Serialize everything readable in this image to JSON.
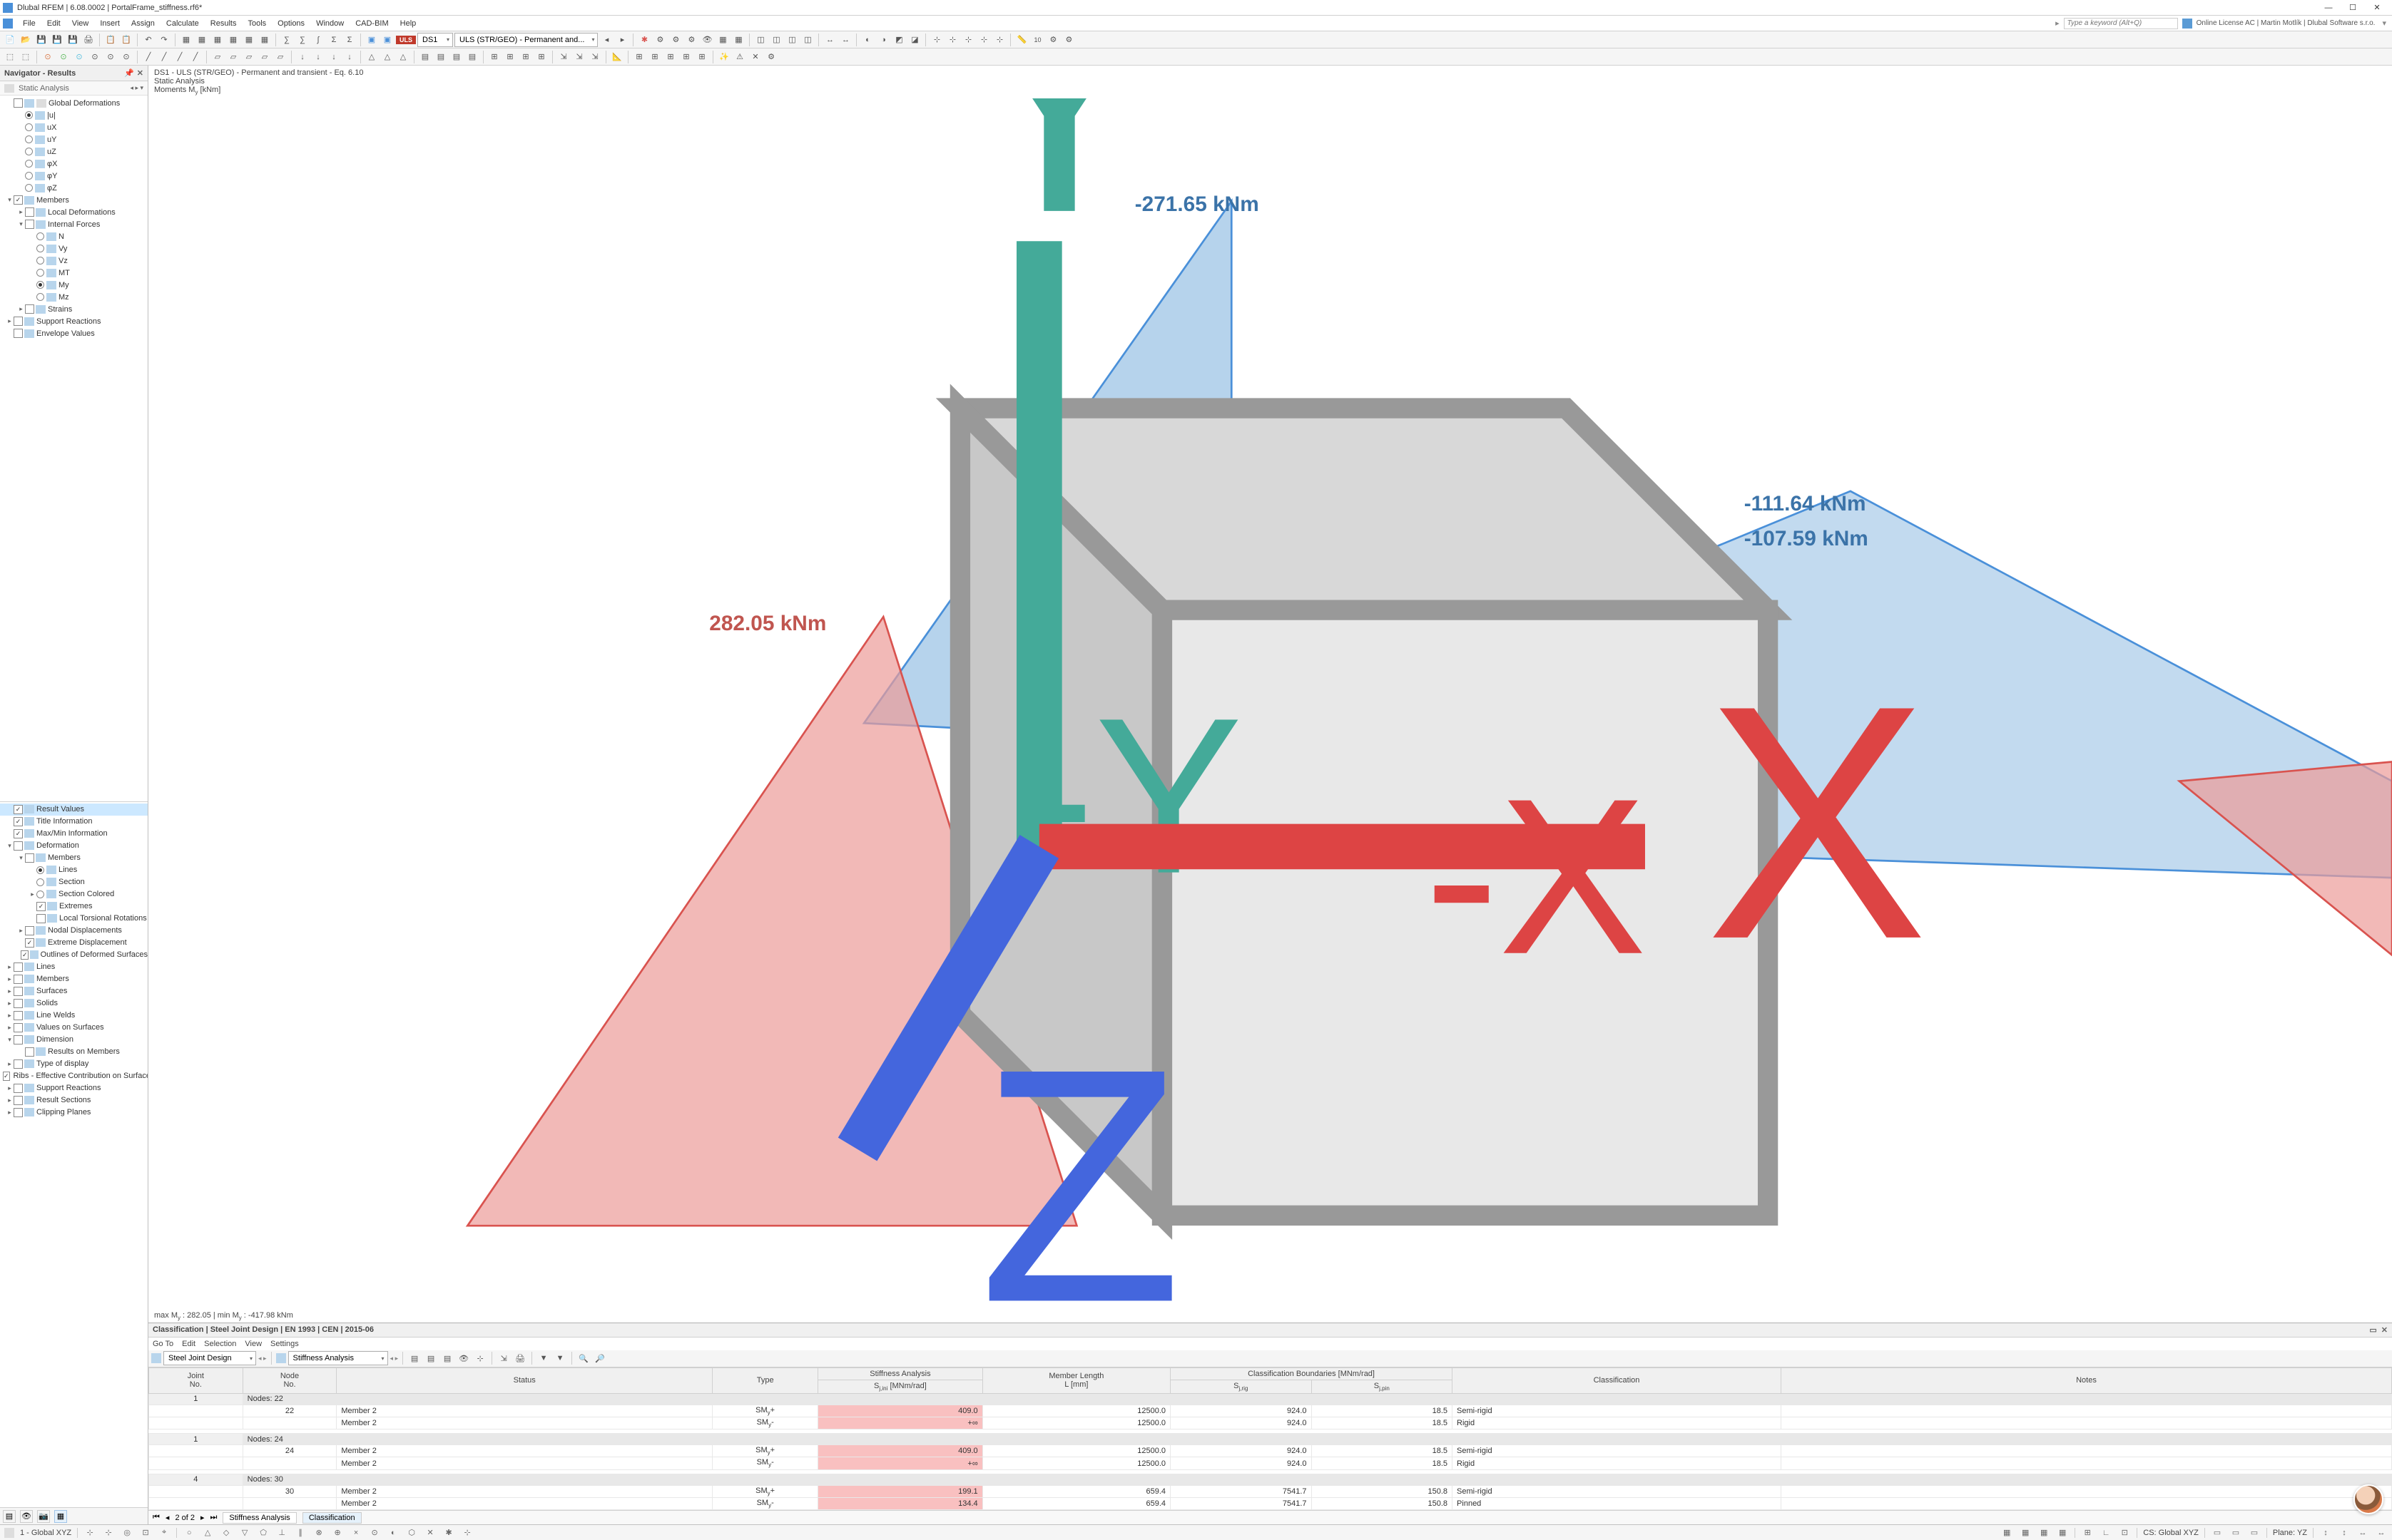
{
  "titlebar": {
    "title": "Dlubal RFEM | 6.08.0002 | PortalFrame_stiffness.rf6*"
  },
  "menubar": {
    "items": [
      "File",
      "Edit",
      "View",
      "Insert",
      "Assign",
      "Calculate",
      "Results",
      "Tools",
      "Options",
      "Window",
      "CAD-BIM",
      "Help"
    ],
    "search_placeholder": "Type a keyword (Alt+Q)",
    "license": "Online License AC | Martin Motlík | Dlubal Software s.r.o."
  },
  "toolbar1": {
    "dd1": "DS1",
    "dd2": "ULS (STR/GEO) - Permanent and...",
    "uls_badge": "ULS"
  },
  "navigator": {
    "title": "Navigator - Results",
    "selector": "Static Analysis",
    "tree_top": [
      {
        "indent": 0,
        "exp": "",
        "check": false,
        "icons": 2,
        "label": "Global Deformations"
      },
      {
        "indent": 1,
        "radio": true,
        "checked": true,
        "icons": 1,
        "label": "|u|"
      },
      {
        "indent": 1,
        "radio": true,
        "checked": false,
        "icons": 1,
        "label": "uX"
      },
      {
        "indent": 1,
        "radio": true,
        "checked": false,
        "icons": 1,
        "label": "uY"
      },
      {
        "indent": 1,
        "radio": true,
        "checked": false,
        "icons": 1,
        "label": "uZ"
      },
      {
        "indent": 1,
        "radio": true,
        "checked": false,
        "icons": 1,
        "label": "φX"
      },
      {
        "indent": 1,
        "radio": true,
        "checked": false,
        "icons": 1,
        "label": "φY"
      },
      {
        "indent": 1,
        "radio": true,
        "checked": false,
        "icons": 1,
        "label": "φZ"
      },
      {
        "indent": 0,
        "exp": "▾",
        "check": true,
        "icons": 1,
        "label": "Members"
      },
      {
        "indent": 1,
        "exp": "▸",
        "check": false,
        "icons": 1,
        "label": "Local Deformations"
      },
      {
        "indent": 1,
        "exp": "▾",
        "check": false,
        "icons": 1,
        "label": "Internal Forces"
      },
      {
        "indent": 2,
        "radio": true,
        "checked": false,
        "icons": 1,
        "label": "N"
      },
      {
        "indent": 2,
        "radio": true,
        "checked": false,
        "icons": 1,
        "label": "Vy"
      },
      {
        "indent": 2,
        "radio": true,
        "checked": false,
        "icons": 1,
        "label": "Vz"
      },
      {
        "indent": 2,
        "radio": true,
        "checked": false,
        "icons": 1,
        "label": "MT"
      },
      {
        "indent": 2,
        "radio": true,
        "checked": true,
        "icons": 1,
        "label": "My"
      },
      {
        "indent": 2,
        "radio": true,
        "checked": false,
        "icons": 1,
        "label": "Mz"
      },
      {
        "indent": 1,
        "exp": "▸",
        "check": false,
        "icons": 1,
        "label": "Strains"
      },
      {
        "indent": 0,
        "exp": "▸",
        "check": false,
        "icons": 1,
        "label": "Support Reactions"
      },
      {
        "indent": 0,
        "exp": "",
        "check": false,
        "icons": 1,
        "label": "Envelope Values"
      }
    ],
    "tree_mid": [
      {
        "indent": 0,
        "check": true,
        "icons": 1,
        "label": "Result Values",
        "selected": true
      },
      {
        "indent": 0,
        "check": true,
        "icons": 1,
        "label": "Title Information"
      },
      {
        "indent": 0,
        "check": true,
        "icons": 1,
        "label": "Max/Min Information"
      },
      {
        "indent": 0,
        "exp": "▾",
        "check": false,
        "icons": 1,
        "label": "Deformation"
      },
      {
        "indent": 1,
        "exp": "▾",
        "check": false,
        "icons": 1,
        "label": "Members"
      },
      {
        "indent": 2,
        "radio": true,
        "checked": true,
        "icons": 1,
        "label": "Lines"
      },
      {
        "indent": 2,
        "radio": true,
        "checked": false,
        "icons": 1,
        "label": "Section"
      },
      {
        "indent": 2,
        "exp": "▸",
        "radio": true,
        "checked": false,
        "icons": 1,
        "label": "Section Colored"
      },
      {
        "indent": 2,
        "check": true,
        "icons": 1,
        "label": "Extremes"
      },
      {
        "indent": 2,
        "check": false,
        "icons": 1,
        "label": "Local Torsional Rotations"
      },
      {
        "indent": 1,
        "exp": "▸",
        "check": false,
        "icons": 1,
        "label": "Nodal Displacements"
      },
      {
        "indent": 1,
        "check": true,
        "icons": 1,
        "label": "Extreme Displacement"
      },
      {
        "indent": 1,
        "check": true,
        "icons": 1,
        "label": "Outlines of Deformed Surfaces"
      },
      {
        "indent": 0,
        "exp": "▸",
        "check": false,
        "icons": 1,
        "label": "Lines"
      },
      {
        "indent": 0,
        "exp": "▸",
        "check": false,
        "icons": 1,
        "label": "Members"
      },
      {
        "indent": 0,
        "exp": "▸",
        "check": false,
        "icons": 1,
        "label": "Surfaces"
      },
      {
        "indent": 0,
        "exp": "▸",
        "check": false,
        "icons": 1,
        "label": "Solids"
      },
      {
        "indent": 0,
        "exp": "▸",
        "check": false,
        "icons": 1,
        "label": "Line Welds"
      },
      {
        "indent": 0,
        "exp": "▸",
        "check": false,
        "icons": 1,
        "label": "Values on Surfaces"
      },
      {
        "indent": 0,
        "exp": "▾",
        "check": false,
        "icons": 1,
        "label": "Dimension"
      },
      {
        "indent": 1,
        "check": false,
        "icons": 1,
        "label": "Results on Members"
      },
      {
        "indent": 0,
        "exp": "▸",
        "check": false,
        "icons": 1,
        "label": "Type of display"
      },
      {
        "indent": 0,
        "check": true,
        "icons": 1,
        "label": "Ribs - Effective Contribution on Surface/Mem..."
      },
      {
        "indent": 0,
        "exp": "▸",
        "check": false,
        "icons": 1,
        "label": "Support Reactions"
      },
      {
        "indent": 0,
        "exp": "▸",
        "check": false,
        "icons": 1,
        "label": "Result Sections"
      },
      {
        "indent": 0,
        "exp": "▸",
        "check": false,
        "icons": 1,
        "label": "Clipping Planes"
      }
    ]
  },
  "viewport": {
    "line1": "DS1 - ULS (STR/GEO) - Permanent and transient - Eq. 6.10",
    "line2": "Static Analysis",
    "line3": "Moments My [kNm]",
    "labels": {
      "top": "-271.65 kNm",
      "right1": "-111.64 kNm",
      "right2": "-107.59 kNm",
      "left": "282.05 kNm"
    },
    "footer": "max My : 282.05 | min My : -417.98 kNm"
  },
  "table": {
    "title": "Classification | Steel Joint Design | EN 1993 | CEN | 2015-06",
    "menu": [
      "Go To",
      "Edit",
      "Selection",
      "View",
      "Settings"
    ],
    "dd1": "Steel Joint Design",
    "dd2": "Stiffness Analysis",
    "headers": {
      "joint": "Joint\nNo.",
      "node": "Node\nNo.",
      "status": "Status",
      "type": "Type",
      "stiff_group": "Stiffness Analysis",
      "sj": "Sj,ini [MNm/rad]",
      "len": "Member Length\nL [mm]",
      "class_group": "Classification Boundaries [MNm/rad]",
      "sjrig": "Sj,rig",
      "sjpin": "Sj,pin",
      "classification": "Classification",
      "notes": "Notes"
    },
    "groups": [
      {
        "joint": "1",
        "node_header": "Nodes: 22",
        "rows": [
          {
            "node": "22",
            "status": "Member 2",
            "type": "SMy+",
            "sj": "409.0",
            "pink": true,
            "len": "12500.0",
            "sjrig": "924.0",
            "sjpin": "18.5",
            "class": "Semi-rigid"
          },
          {
            "node": "",
            "status": "Member 2",
            "type": "SMy-",
            "sj": "+∞",
            "pink": true,
            "len": "12500.0",
            "sjrig": "924.0",
            "sjpin": "18.5",
            "class": "Rigid"
          }
        ]
      },
      {
        "joint": "1",
        "node_header": "Nodes: 24",
        "rows": [
          {
            "node": "24",
            "status": "Member 2",
            "type": "SMy+",
            "sj": "409.0",
            "pink": true,
            "len": "12500.0",
            "sjrig": "924.0",
            "sjpin": "18.5",
            "class": "Semi-rigid"
          },
          {
            "node": "",
            "status": "Member 2",
            "type": "SMy-",
            "sj": "+∞",
            "pink": true,
            "len": "12500.0",
            "sjrig": "924.0",
            "sjpin": "18.5",
            "class": "Rigid"
          }
        ]
      },
      {
        "joint": "4",
        "node_header": "Nodes: 30",
        "rows": [
          {
            "node": "30",
            "status": "Member 2",
            "type": "SMy+",
            "sj": "199.1",
            "pink": true,
            "len": "659.4",
            "sjrig": "7541.7",
            "sjpin": "150.8",
            "class": "Semi-rigid"
          },
          {
            "node": "",
            "status": "Member 2",
            "type": "SMy-",
            "sj": "134.4",
            "pink": true,
            "len": "659.4",
            "sjrig": "7541.7",
            "sjpin": "150.8",
            "class": "Pinned"
          }
        ]
      }
    ],
    "pager": {
      "pos": "2 of 2",
      "tabs": [
        "Stiffness Analysis",
        "Classification"
      ]
    }
  },
  "statusbar": {
    "left": "1 - Global XYZ",
    "cs": "CS: Global XYZ",
    "plane": "Plane: YZ"
  }
}
